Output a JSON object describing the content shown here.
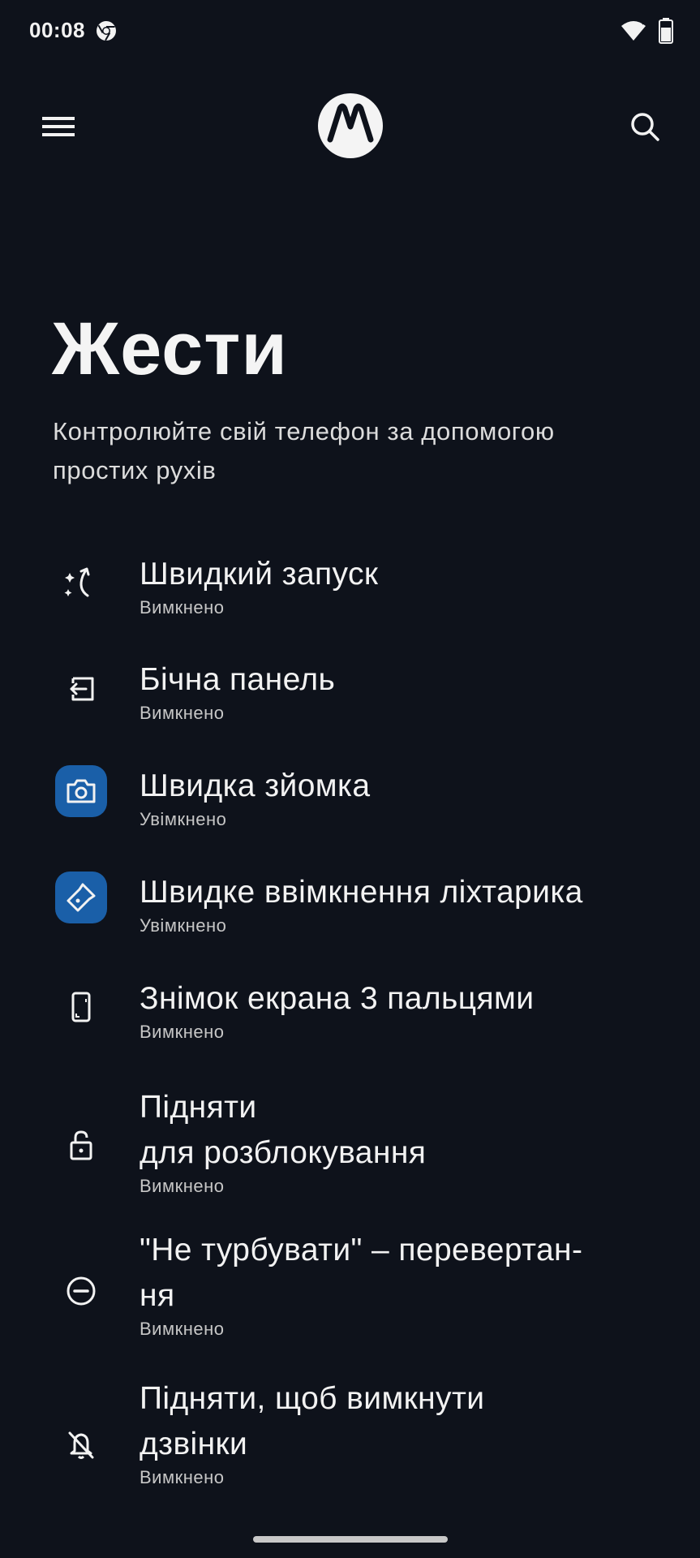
{
  "status_bar": {
    "time": "00:08",
    "icons": [
      "chrome-icon",
      "wifi-icon",
      "battery-icon"
    ]
  },
  "top_bar": {
    "menu_icon": "hamburger-icon",
    "logo": "motorola-logo",
    "search_icon": "search-icon"
  },
  "page": {
    "title": "Жести",
    "subtitle": "Контролюйте свій телефон за допомогою простих рухів"
  },
  "items": [
    {
      "title": "Швидкий запуск",
      "status": "Вимкнено",
      "icon": "sparkle-rotate-icon",
      "enabled": false
    },
    {
      "title": "Бічна панель",
      "status": "Вимкнено",
      "icon": "side-panel-icon",
      "enabled": false
    },
    {
      "title": "Швидка зйомка",
      "status": "Увімкнено",
      "icon": "camera-icon",
      "enabled": true
    },
    {
      "title": "Швидке ввімкнення ліхтарика",
      "status": "Увімкнено",
      "icon": "flashlight-icon",
      "enabled": true
    },
    {
      "title": "Знімок екрана 3 пальцями",
      "status": "Вимкнено",
      "icon": "phone-screenshot-icon",
      "enabled": false
    },
    {
      "title": "Підняти\nдля розблокування",
      "status": "Вимкнено",
      "icon": "lock-icon",
      "enabled": false
    },
    {
      "title": "\"Не турбувати\" – перевертан-\nня",
      "status": "Вимкнено",
      "icon": "do-not-disturb-icon",
      "enabled": false
    },
    {
      "title": "Підняти, щоб вимкнути\nдзвінки",
      "status": "Вимкнено",
      "icon": "bell-off-icon",
      "enabled": false
    }
  ],
  "colors": {
    "background": "#0e121b",
    "accent": "#1a5fa8",
    "text": "#f2f2f2"
  }
}
